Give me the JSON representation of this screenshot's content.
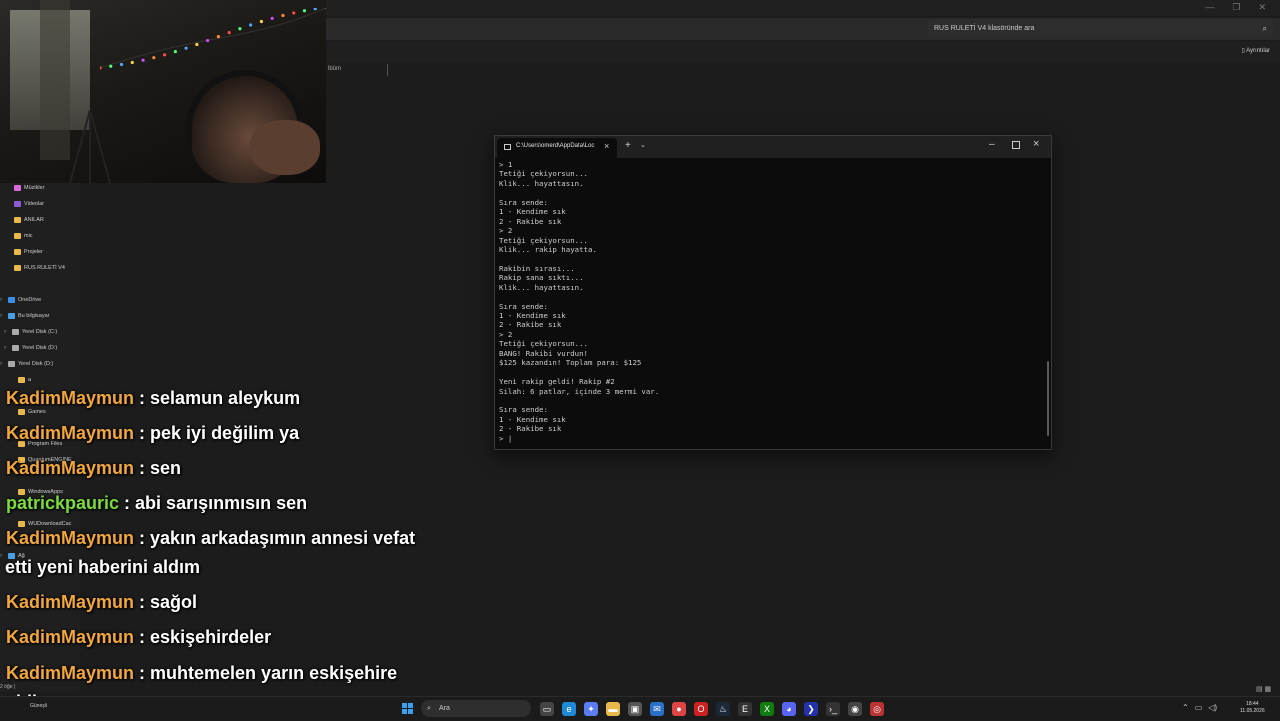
{
  "explorer": {
    "search_placeholder": "RUS RULETİ V4 klasöründe ara",
    "details_label": "Ayrıntılar",
    "column_header": "lbüm",
    "sidebar_items": [
      {
        "label": "Müzikler",
        "color": "#d96ad9",
        "top": 0
      },
      {
        "label": "Videolar",
        "color": "#8a5ad9"
      },
      {
        "label": "ANILAR",
        "color": "#e8b84a"
      },
      {
        "label": "mic",
        "color": "#e8b84a"
      },
      {
        "label": "Projeler",
        "color": "#e8b84a"
      },
      {
        "label": "RUS RULETİ V4",
        "color": "#e8b84a"
      },
      {
        "label": "OneDrive",
        "color": "#3a8ee6"
      },
      {
        "label": "Bu bilgisayar",
        "color": "#4aa0e6"
      },
      {
        "label": "Yerel Disk (C:)",
        "color": "#aaaaaa"
      },
      {
        "label": "Yerel Disk (D:)",
        "color": "#aaaaaa"
      },
      {
        "label": "Yerel Disk (D:)",
        "color": "#aaaaaa"
      },
      {
        "label": "a",
        "color": "#e8b84a"
      },
      {
        "label": "Games",
        "color": "#e8b84a"
      },
      {
        "label": "Program Files",
        "color": "#e8b84a"
      },
      {
        "label": "QuantumENGINE",
        "color": "#e8b84a"
      },
      {
        "label": "WindowsApps",
        "color": "#e8b84a"
      },
      {
        "label": "WUDownloadCac",
        "color": "#e8b84a"
      },
      {
        "label": "Ağ",
        "color": "#4aa0e6"
      }
    ],
    "status": "2 öğe  |"
  },
  "terminal": {
    "tab_title": "C:\\Users\\omerd\\AppData\\Loc",
    "lines": [
      "> 1",
      "Tetiği çekiyorsun...",
      "Klik... hayattasın.",
      "",
      "Sıra sende:",
      "1 - Kendime sık",
      "2 - Rakibe sık",
      "> 2",
      "Tetiği çekiyorsun...",
      "Klik... rakip hayatta.",
      "",
      "Rakibin sırası...",
      "Rakip sana sıktı...",
      "Klik... hayattasın.",
      "",
      "Sıra sende:",
      "1 - Kendime sık",
      "2 - Rakibe sık",
      "> 2",
      "Tetiği çekiyorsun...",
      "BANG! Rakibi vurdun!",
      "$125 kazandın! Toplam para: $125",
      "",
      "Yeni rakip geldi! Rakip #2",
      "Silah: 6 patlar, içinde 3 mermi var.",
      "",
      "Sıra sende:",
      "1 - Kendime sık",
      "2 - Rakibe sık",
      "> |"
    ]
  },
  "chat": {
    "messages": [
      {
        "user": "KadimMaymun",
        "text": "selamun aleykum",
        "color": "#f3a73a"
      },
      {
        "user": "KadimMaymun",
        "text": "pek iyi değilim ya",
        "color": "#f3a73a"
      },
      {
        "user": "KadimMaymun",
        "text": "sen",
        "color": "#f3a73a"
      },
      {
        "user": "patrickpauric",
        "text": "abi sarışınmısın sen",
        "color": "#7bdc3a"
      },
      {
        "user": "KadimMaymun",
        "text": "yakın arkadaşımın annesi vefat",
        "color": "#f3a73a",
        "continuation": "etti yeni haberini aldım"
      },
      {
        "user": "KadimMaymun",
        "text": "sağol",
        "color": "#f3a73a"
      },
      {
        "user": "KadimMaymun",
        "text": "eskişehirdeler",
        "color": "#f3a73a"
      },
      {
        "user": "KadimMaymun",
        "text": "muhtemelen yarın eskişehire",
        "color": "#f3a73a",
        "continuation": "gidicem"
      }
    ]
  },
  "taskbar": {
    "search_label": "Ara",
    "weather": "Güneşli",
    "time": "18:44",
    "date": "11.05.2026"
  }
}
